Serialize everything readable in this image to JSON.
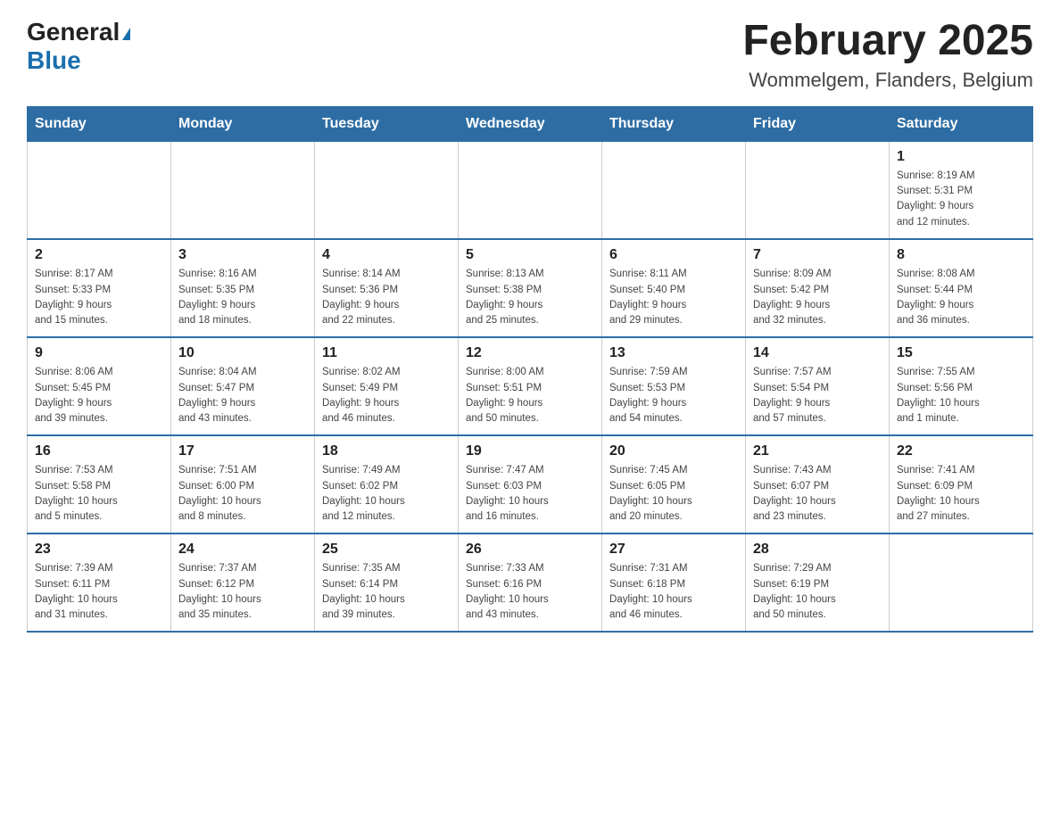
{
  "logo": {
    "general": "General",
    "blue": "Blue"
  },
  "header": {
    "month": "February 2025",
    "location": "Wommelgem, Flanders, Belgium"
  },
  "weekdays": [
    "Sunday",
    "Monday",
    "Tuesday",
    "Wednesday",
    "Thursday",
    "Friday",
    "Saturday"
  ],
  "weeks": [
    [
      {
        "day": "",
        "info": ""
      },
      {
        "day": "",
        "info": ""
      },
      {
        "day": "",
        "info": ""
      },
      {
        "day": "",
        "info": ""
      },
      {
        "day": "",
        "info": ""
      },
      {
        "day": "",
        "info": ""
      },
      {
        "day": "1",
        "info": "Sunrise: 8:19 AM\nSunset: 5:31 PM\nDaylight: 9 hours\nand 12 minutes."
      }
    ],
    [
      {
        "day": "2",
        "info": "Sunrise: 8:17 AM\nSunset: 5:33 PM\nDaylight: 9 hours\nand 15 minutes."
      },
      {
        "day": "3",
        "info": "Sunrise: 8:16 AM\nSunset: 5:35 PM\nDaylight: 9 hours\nand 18 minutes."
      },
      {
        "day": "4",
        "info": "Sunrise: 8:14 AM\nSunset: 5:36 PM\nDaylight: 9 hours\nand 22 minutes."
      },
      {
        "day": "5",
        "info": "Sunrise: 8:13 AM\nSunset: 5:38 PM\nDaylight: 9 hours\nand 25 minutes."
      },
      {
        "day": "6",
        "info": "Sunrise: 8:11 AM\nSunset: 5:40 PM\nDaylight: 9 hours\nand 29 minutes."
      },
      {
        "day": "7",
        "info": "Sunrise: 8:09 AM\nSunset: 5:42 PM\nDaylight: 9 hours\nand 32 minutes."
      },
      {
        "day": "8",
        "info": "Sunrise: 8:08 AM\nSunset: 5:44 PM\nDaylight: 9 hours\nand 36 minutes."
      }
    ],
    [
      {
        "day": "9",
        "info": "Sunrise: 8:06 AM\nSunset: 5:45 PM\nDaylight: 9 hours\nand 39 minutes."
      },
      {
        "day": "10",
        "info": "Sunrise: 8:04 AM\nSunset: 5:47 PM\nDaylight: 9 hours\nand 43 minutes."
      },
      {
        "day": "11",
        "info": "Sunrise: 8:02 AM\nSunset: 5:49 PM\nDaylight: 9 hours\nand 46 minutes."
      },
      {
        "day": "12",
        "info": "Sunrise: 8:00 AM\nSunset: 5:51 PM\nDaylight: 9 hours\nand 50 minutes."
      },
      {
        "day": "13",
        "info": "Sunrise: 7:59 AM\nSunset: 5:53 PM\nDaylight: 9 hours\nand 54 minutes."
      },
      {
        "day": "14",
        "info": "Sunrise: 7:57 AM\nSunset: 5:54 PM\nDaylight: 9 hours\nand 57 minutes."
      },
      {
        "day": "15",
        "info": "Sunrise: 7:55 AM\nSunset: 5:56 PM\nDaylight: 10 hours\nand 1 minute."
      }
    ],
    [
      {
        "day": "16",
        "info": "Sunrise: 7:53 AM\nSunset: 5:58 PM\nDaylight: 10 hours\nand 5 minutes."
      },
      {
        "day": "17",
        "info": "Sunrise: 7:51 AM\nSunset: 6:00 PM\nDaylight: 10 hours\nand 8 minutes."
      },
      {
        "day": "18",
        "info": "Sunrise: 7:49 AM\nSunset: 6:02 PM\nDaylight: 10 hours\nand 12 minutes."
      },
      {
        "day": "19",
        "info": "Sunrise: 7:47 AM\nSunset: 6:03 PM\nDaylight: 10 hours\nand 16 minutes."
      },
      {
        "day": "20",
        "info": "Sunrise: 7:45 AM\nSunset: 6:05 PM\nDaylight: 10 hours\nand 20 minutes."
      },
      {
        "day": "21",
        "info": "Sunrise: 7:43 AM\nSunset: 6:07 PM\nDaylight: 10 hours\nand 23 minutes."
      },
      {
        "day": "22",
        "info": "Sunrise: 7:41 AM\nSunset: 6:09 PM\nDaylight: 10 hours\nand 27 minutes."
      }
    ],
    [
      {
        "day": "23",
        "info": "Sunrise: 7:39 AM\nSunset: 6:11 PM\nDaylight: 10 hours\nand 31 minutes."
      },
      {
        "day": "24",
        "info": "Sunrise: 7:37 AM\nSunset: 6:12 PM\nDaylight: 10 hours\nand 35 minutes."
      },
      {
        "day": "25",
        "info": "Sunrise: 7:35 AM\nSunset: 6:14 PM\nDaylight: 10 hours\nand 39 minutes."
      },
      {
        "day": "26",
        "info": "Sunrise: 7:33 AM\nSunset: 6:16 PM\nDaylight: 10 hours\nand 43 minutes."
      },
      {
        "day": "27",
        "info": "Sunrise: 7:31 AM\nSunset: 6:18 PM\nDaylight: 10 hours\nand 46 minutes."
      },
      {
        "day": "28",
        "info": "Sunrise: 7:29 AM\nSunset: 6:19 PM\nDaylight: 10 hours\nand 50 minutes."
      },
      {
        "day": "",
        "info": ""
      }
    ]
  ]
}
